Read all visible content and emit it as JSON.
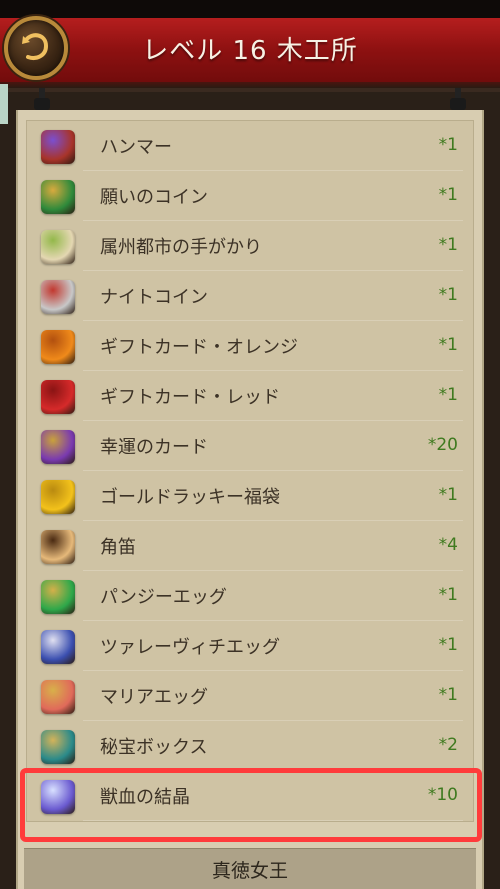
{
  "header": {
    "title": "レベル 16 木工所"
  },
  "items": [
    {
      "name": "ハンマー",
      "qty": "*1",
      "icon": "hammer-icon",
      "c1": "#a8342a",
      "c2": "#7b4fd0"
    },
    {
      "name": "願いのコイン",
      "qty": "*1",
      "icon": "wish-coin-icon",
      "c1": "#2f8a3b",
      "c2": "#d8aa3e"
    },
    {
      "name": "属州都市の手がかり",
      "qty": "*1",
      "icon": "scroll-map-icon",
      "c1": "#e4d7b2",
      "c2": "#93b84a"
    },
    {
      "name": "ナイトコイン",
      "qty": "*1",
      "icon": "knight-coin-icon",
      "c1": "#c8c8c8",
      "c2": "#c2382f"
    },
    {
      "name": "ギフトカード・オレンジ",
      "qty": "*1",
      "icon": "gift-card-orange-icon",
      "c1": "#f08a1a",
      "c2": "#b2500f"
    },
    {
      "name": "ギフトカード・レッド",
      "qty": "*1",
      "icon": "gift-card-red-icon",
      "c1": "#d62a2a",
      "c2": "#8a1414"
    },
    {
      "name": "幸運のカード",
      "qty": "*20",
      "icon": "lucky-card-icon",
      "c1": "#7a3ab0",
      "c2": "#c9a13b"
    },
    {
      "name": "ゴールドラッキー福袋",
      "qty": "*1",
      "icon": "gold-lucky-bag-icon",
      "c1": "#f3c21b",
      "c2": "#b98a10"
    },
    {
      "name": "角笛",
      "qty": "*4",
      "icon": "horn-icon",
      "c1": "#e6b97a",
      "c2": "#4a2a12"
    },
    {
      "name": "パンジーエッグ",
      "qty": "*1",
      "icon": "pansy-egg-icon",
      "c1": "#2ea84a",
      "c2": "#d4b04a"
    },
    {
      "name": "ツァレーヴィチエッグ",
      "qty": "*1",
      "icon": "tsarevich-egg-icon",
      "c1": "#3b4fb0",
      "c2": "#e0e0f0"
    },
    {
      "name": "マリアエッグ",
      "qty": "*1",
      "icon": "maria-egg-icon",
      "c1": "#e06a5a",
      "c2": "#d8b04a"
    },
    {
      "name": "秘宝ボックス",
      "qty": "*2",
      "icon": "treasure-box-icon",
      "c1": "#2a8a8a",
      "c2": "#d3b35a"
    },
    {
      "name": "獣血の結晶",
      "qty": "*10",
      "icon": "beast-blood-crystal-icon",
      "c1": "#6a5ad0",
      "c2": "#d8e0ff"
    }
  ],
  "footer": {
    "label": "真徳女王"
  }
}
